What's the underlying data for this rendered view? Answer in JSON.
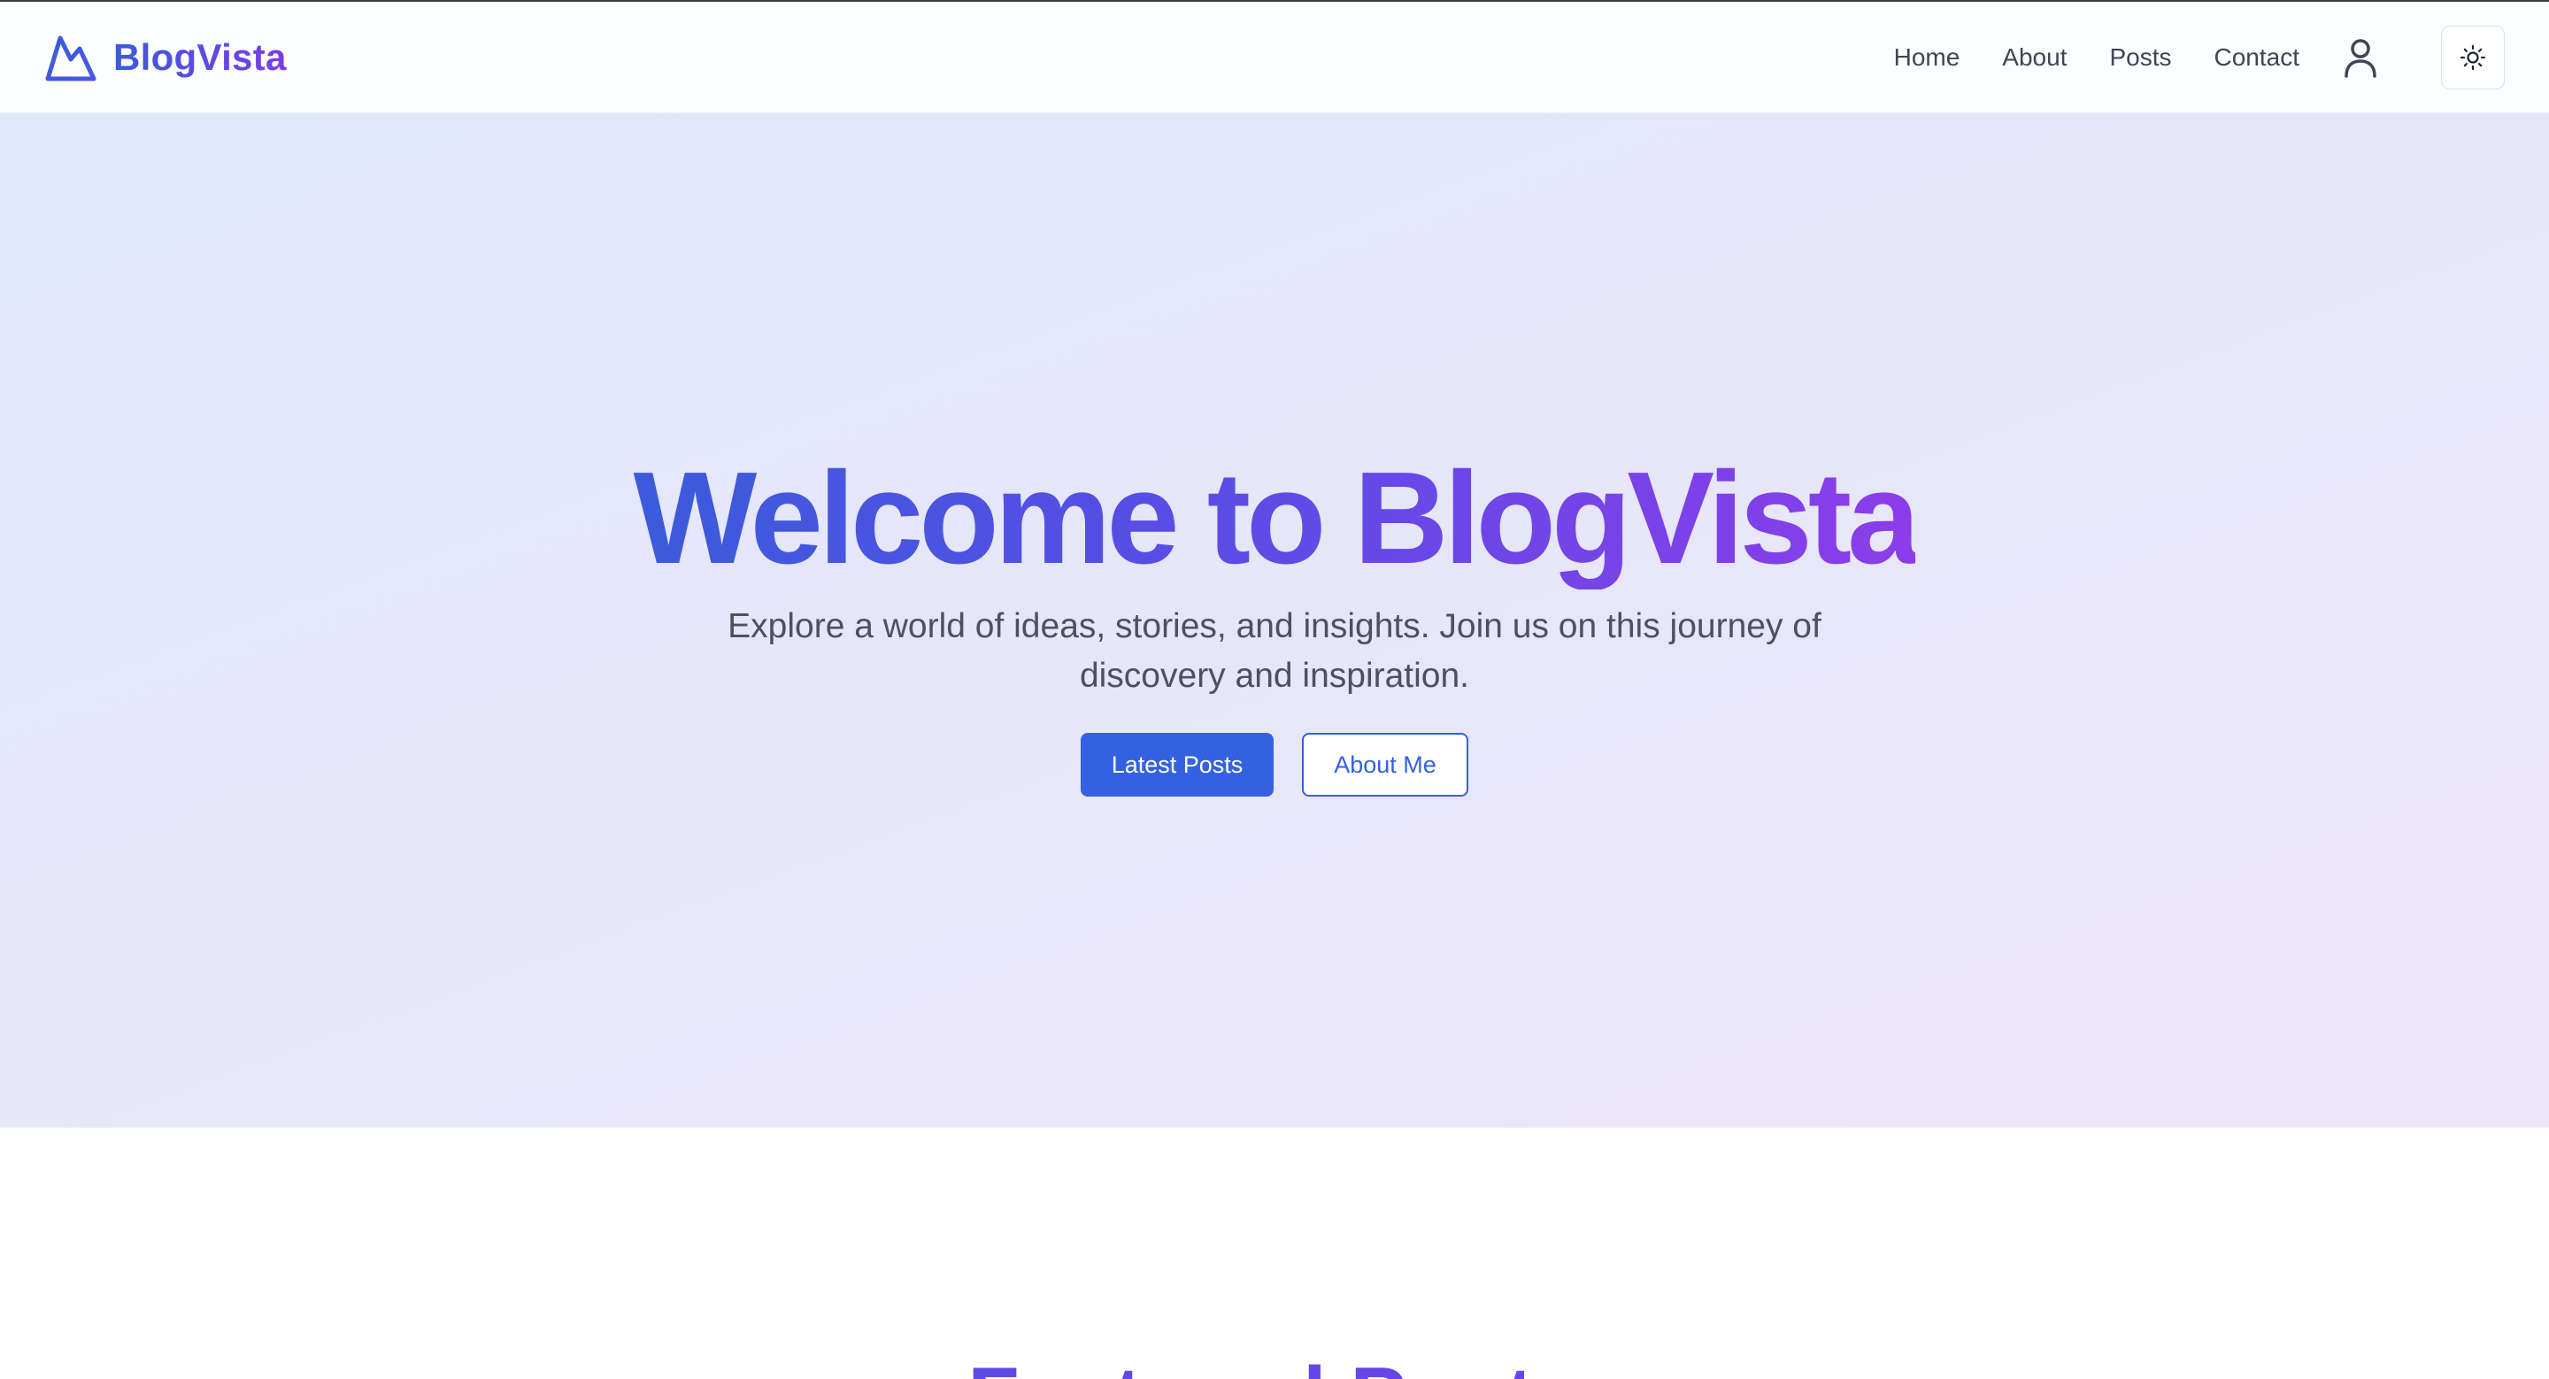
{
  "brand": {
    "name": "BlogVista",
    "icon": "mountain-icon",
    "gradient_start": "#3b5bdb",
    "gradient_end": "#7c3aed"
  },
  "nav": {
    "links": [
      "Home",
      "About",
      "Posts",
      "Contact"
    ],
    "user_icon": "user-icon",
    "theme_icon": "sun-icon"
  },
  "hero": {
    "title": "Welcome to BlogVista",
    "subtitle": "Explore a world of ideas, stories, and insights. Join us on this journey of discovery and inspiration.",
    "primary_button": "Latest Posts",
    "secondary_button": "About Me"
  },
  "featured": {
    "title": "Featured Posts"
  },
  "colors": {
    "accent": "#3461e0",
    "hero_bg_start": "#e1e8fb",
    "hero_bg_end": "#ede6fb",
    "nav_text": "#3f4553"
  }
}
